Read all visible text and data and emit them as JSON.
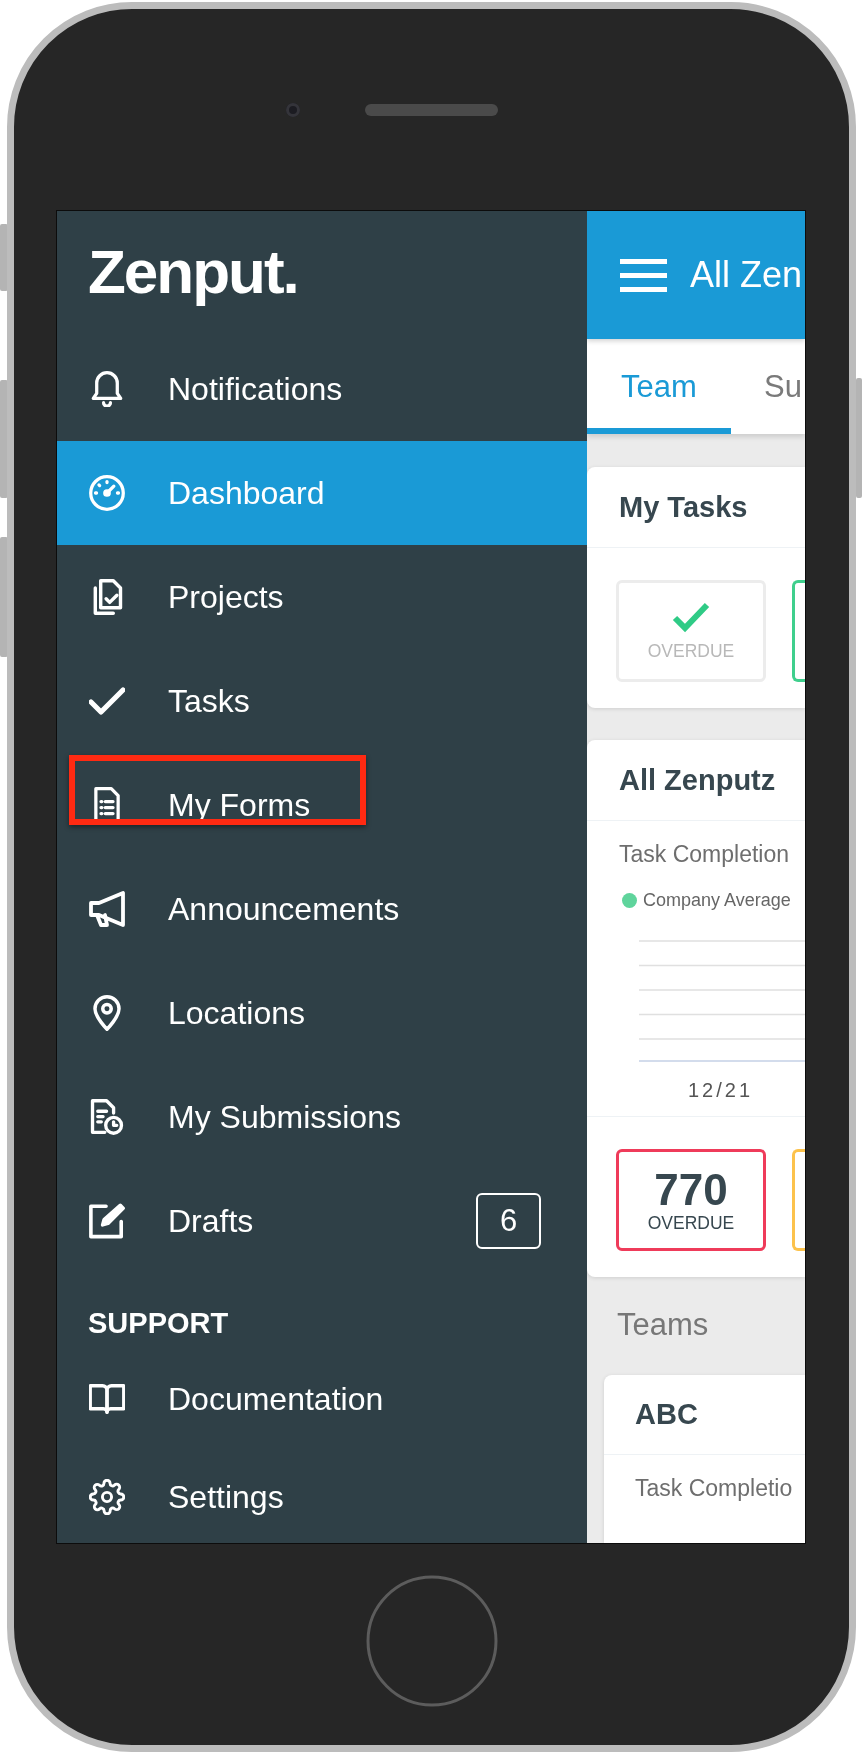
{
  "sidebar": {
    "logo": "Zenput.",
    "items": [
      {
        "label": "Notifications",
        "selected": false,
        "highlighted": false
      },
      {
        "label": "Dashboard",
        "selected": true,
        "highlighted": false
      },
      {
        "label": "Projects",
        "selected": false,
        "highlighted": false
      },
      {
        "label": "Tasks",
        "selected": false,
        "highlighted": false
      },
      {
        "label": "My Forms",
        "selected": false,
        "highlighted": true
      },
      {
        "label": "Announcements",
        "selected": false,
        "highlighted": false
      },
      {
        "label": "Locations",
        "selected": false,
        "highlighted": false
      },
      {
        "label": "My Submissions",
        "selected": false,
        "highlighted": false
      },
      {
        "label": "Drafts",
        "selected": false,
        "highlighted": false,
        "badge": "6"
      }
    ],
    "support": {
      "heading": "SUPPORT",
      "items": [
        {
          "label": "Documentation",
          "selected": false,
          "highlighted": false
        },
        {
          "label": "Settings",
          "selected": false,
          "highlighted": false
        }
      ]
    }
  },
  "header": {
    "title": "All Zen"
  },
  "tabs": [
    {
      "label": "Team",
      "selected": true
    },
    {
      "label": "Su",
      "selected": false
    }
  ],
  "cards": [
    {
      "title": "My Tasks",
      "tiles": [
        {
          "kind": "done",
          "label": "OVERDUE",
          "color": "#ececec"
        },
        {
          "kind": "edge",
          "color": "#3fcf8d"
        }
      ]
    },
    {
      "title": "All Zenputz",
      "subtitle": "Task Completion",
      "chart": {
        "legend": [
          {
            "label": "Company Average",
            "color": "#5fd49c"
          }
        ],
        "x_labels": [
          "12/21"
        ]
      },
      "tiles": [
        {
          "kind": "count",
          "value": "770",
          "label": "OVERDUE",
          "color": "#ef3b5a"
        },
        {
          "kind": "edge",
          "color": "#fcc24c"
        }
      ]
    }
  ],
  "teams": {
    "heading": "Teams",
    "cards": [
      {
        "title": "ABC",
        "subtitle": "Task Completio"
      }
    ]
  }
}
